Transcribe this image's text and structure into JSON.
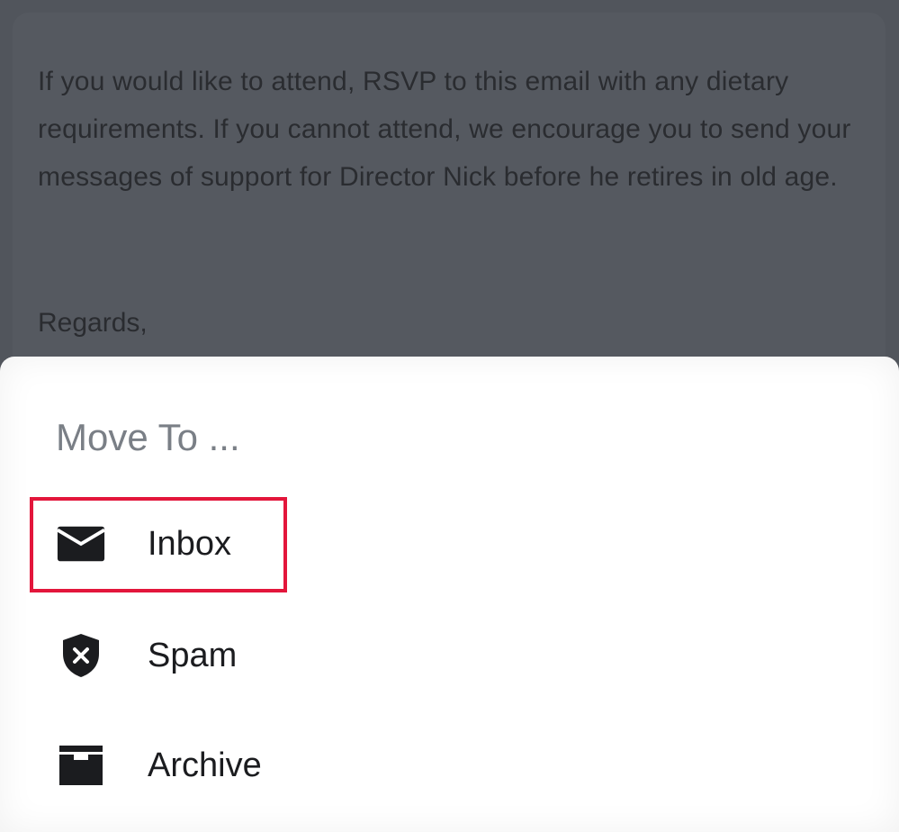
{
  "email": {
    "paragraph": "If you would like to attend, RSVP to this email with any dietary requirements. If you cannot attend, we encourage you to send your messages of support for Director Nick before he retires in old age.",
    "regards": "Regards,"
  },
  "move_sheet": {
    "title": "Move To ...",
    "items": [
      {
        "label": "Inbox",
        "icon": "envelope-icon",
        "highlighted": true
      },
      {
        "label": "Spam",
        "icon": "shield-x-icon",
        "highlighted": false
      },
      {
        "label": "Archive",
        "icon": "archive-box-icon",
        "highlighted": false
      }
    ]
  },
  "colors": {
    "overlay": "#51555c",
    "sheet_background": "#ffffff",
    "highlight": "#e3163b",
    "title_text": "#7a7f86",
    "item_text": "#1b1c1f"
  }
}
